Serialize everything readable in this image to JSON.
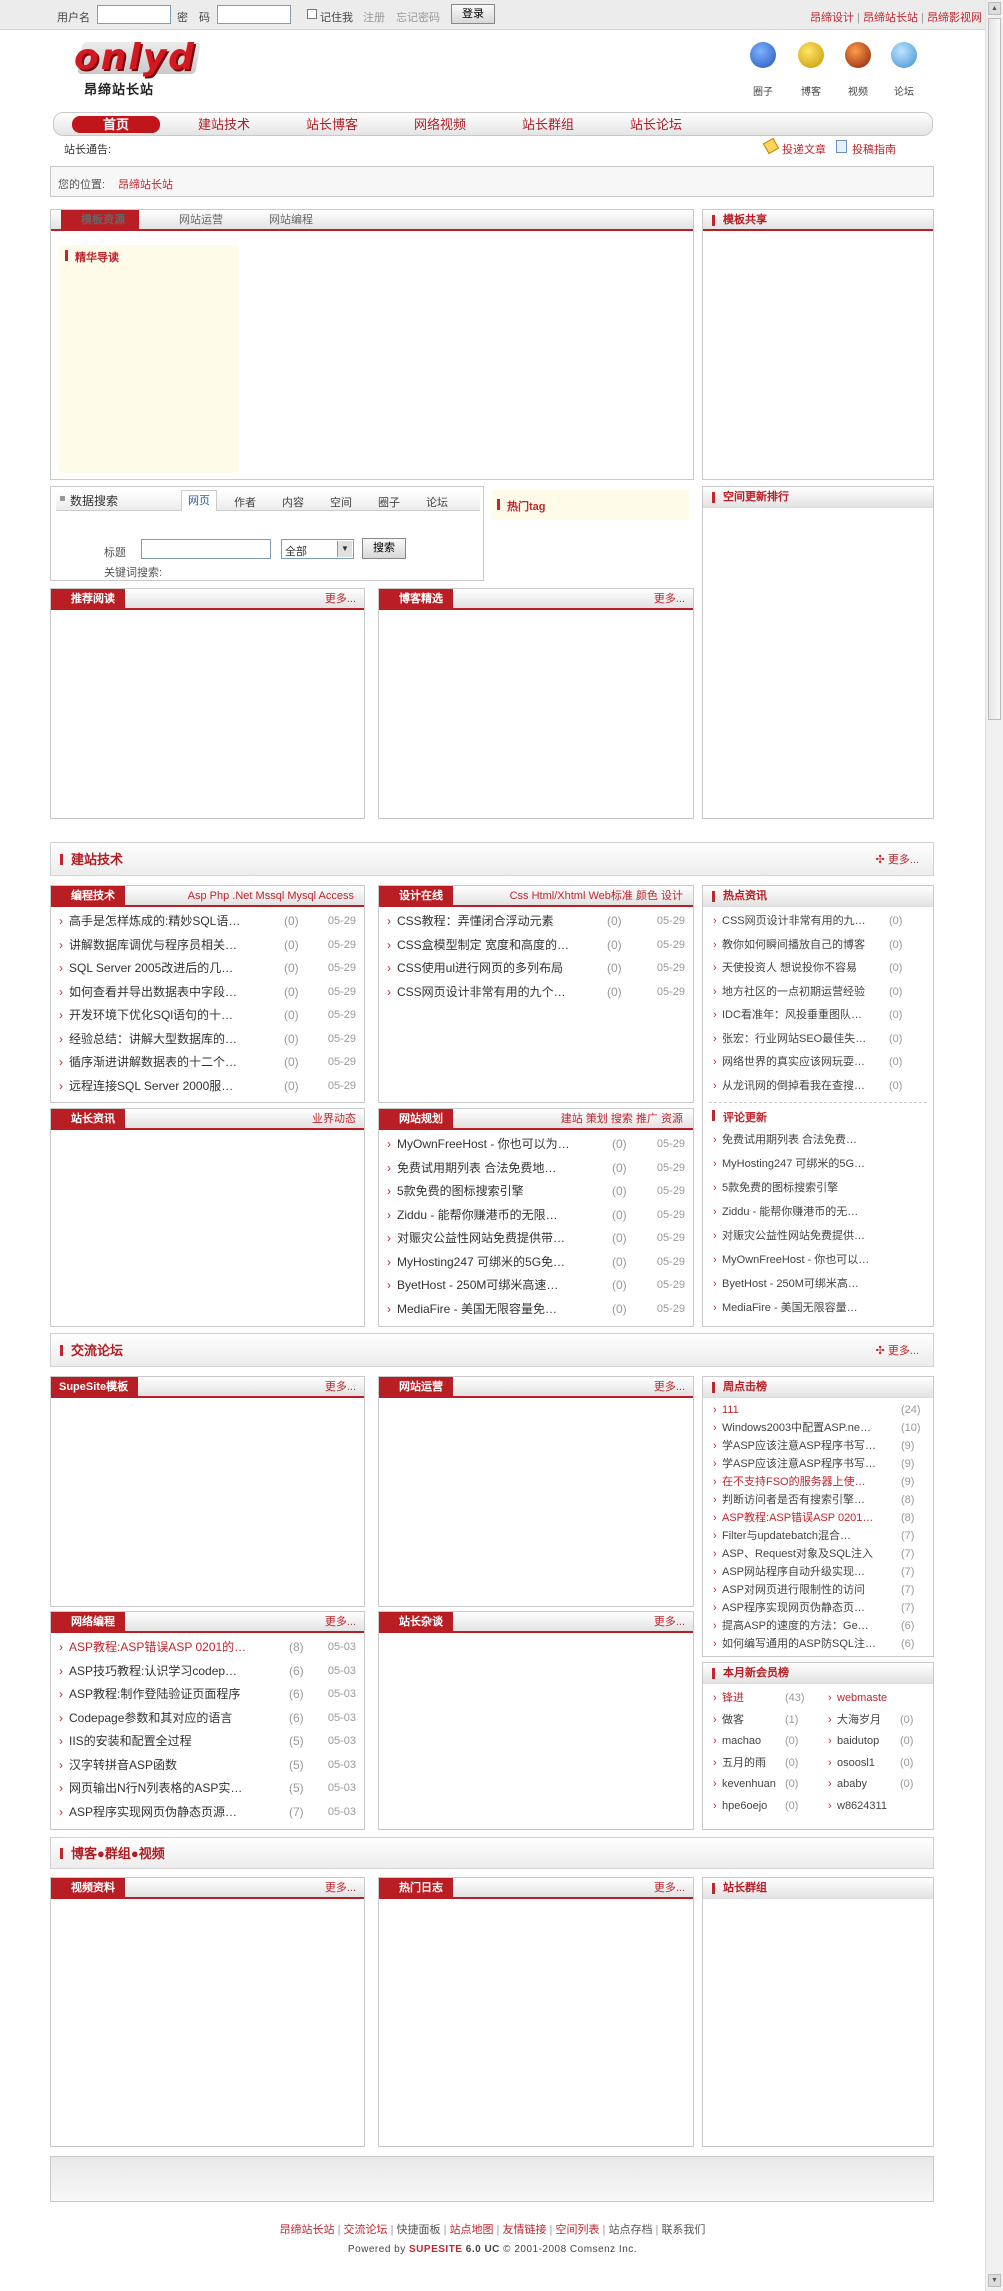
{
  "topbar": {
    "username_label": "用户名",
    "password_label": "密　码",
    "remember_label": "记住我",
    "register_label": "注册",
    "forgot_label": "忘记密码",
    "login_button": "登录",
    "right_links": [
      "昂缔设计",
      "昂缔站长站",
      "昂缔影视网"
    ]
  },
  "logo": {
    "text": "onlyd",
    "subtitle": "昂缔站长站"
  },
  "top_icons": [
    "圈子",
    "博客",
    "视频",
    "论坛"
  ],
  "nav": [
    "首页",
    "建站技术",
    "站长博客",
    "网络视频",
    "站长群组",
    "站长论坛"
  ],
  "notice": {
    "label": "站长通告:",
    "post_link": "投递文章",
    "guide_link": "投稿指南"
  },
  "breadcrumb": {
    "label": "您的位置:",
    "link": "昂缔站长站"
  },
  "tpl_panel": {
    "tabs": [
      "模板资源",
      "网站运营",
      "网站编程"
    ],
    "inner_title": "精华导读"
  },
  "tpl_share": {
    "title": "模板共享"
  },
  "search": {
    "title": "数据搜索",
    "tabs": [
      "网页",
      "作者",
      "内容",
      "空间",
      "圈子",
      "论坛"
    ],
    "field_label": "标题",
    "select_value": "全部",
    "button": "搜索",
    "keywords_label": "关键词搜索:"
  },
  "hot_tag": {
    "title": "热门tag"
  },
  "space_rank": {
    "title": "空间更新排行"
  },
  "recommend": {
    "title": "推荐阅读",
    "more": "更多..."
  },
  "blog_pick": {
    "title": "博客精选",
    "more": "更多..."
  },
  "sec_tech": {
    "title": "建站技术",
    "more": "更多..."
  },
  "prog": {
    "title": "编程技术",
    "links": [
      "Asp",
      "Php",
      ".Net",
      "Mssql",
      "Mysql",
      "Access"
    ],
    "items": [
      {
        "t": "高手是怎样炼成的:精妙SQL语…",
        "c": "(0)",
        "d": "05-29"
      },
      {
        "t": "讲解数据库调优与程序员相关…",
        "c": "(0)",
        "d": "05-29"
      },
      {
        "t": "SQL Server 2005改进后的几…",
        "c": "(0)",
        "d": "05-29"
      },
      {
        "t": "如何查看并导出数据表中字段…",
        "c": "(0)",
        "d": "05-29"
      },
      {
        "t": "开发环境下优化SQl语句的十…",
        "c": "(0)",
        "d": "05-29"
      },
      {
        "t": "经验总结：讲解大型数据库的…",
        "c": "(0)",
        "d": "05-29"
      },
      {
        "t": "循序渐进讲解数据表的十二个…",
        "c": "(0)",
        "d": "05-29"
      },
      {
        "t": "远程连接SQL Server 2000服…",
        "c": "(0)",
        "d": "05-29"
      }
    ]
  },
  "design": {
    "title": "设计在线",
    "links": [
      "Css",
      "Html/Xhtml",
      "Web标准",
      "颜色",
      "设计"
    ],
    "items": [
      {
        "t": "CSS教程：弄懂闭合浮动元素",
        "c": "(0)",
        "d": "05-29"
      },
      {
        "t": "CSS盒模型制定 宽度和高度的…",
        "c": "(0)",
        "d": "05-29"
      },
      {
        "t": "CSS使用ul进行网页的多列布局",
        "c": "(0)",
        "d": "05-29"
      },
      {
        "t": "CSS网页设计非常有用的九个…",
        "c": "(0)",
        "d": "05-29"
      }
    ]
  },
  "hot_news": {
    "title": "热点资讯",
    "items": [
      {
        "t": "CSS网页设计非常有用的九…",
        "c": "(0)"
      },
      {
        "t": "教你如何瞬间播放自己的博客",
        "c": "(0)"
      },
      {
        "t": "天使投资人 想说投你不容易",
        "c": "(0)"
      },
      {
        "t": "地方社区的一点初期运营经验",
        "c": "(0)"
      },
      {
        "t": "IDC看准年：风投垂重图队…",
        "c": "(0)"
      },
      {
        "t": "张宏：行业网站SEO最佳失…",
        "c": "(0)"
      },
      {
        "t": "网络世界的真实应该网玩耍…",
        "c": "(0)"
      },
      {
        "t": "从龙讯网的倒掉看我在查搜…",
        "c": "(0)"
      }
    ]
  },
  "webmaster_news": {
    "title": "站长资讯",
    "more": "业界动态"
  },
  "site_plan": {
    "title": "网站规划",
    "links": [
      "建站",
      "策划",
      "搜索",
      "推广",
      "资源"
    ],
    "items": [
      {
        "t": "MyOwnFreeHost - 你也可以为…",
        "c": "(0)",
        "d": "05-29"
      },
      {
        "t": "免费试用期列表 合法免费地…",
        "c": "(0)",
        "d": "05-29"
      },
      {
        "t": "5款免费的图标搜索引擎",
        "c": "(0)",
        "d": "05-29"
      },
      {
        "t": "Ziddu - 能帮你赚港币的无限…",
        "c": "(0)",
        "d": "05-29"
      },
      {
        "t": "对赈灾公益性网站免费提供带…",
        "c": "(0)",
        "d": "05-29"
      },
      {
        "t": "MyHosting247 可绑米的5G免…",
        "c": "(0)",
        "d": "05-29"
      },
      {
        "t": "ByetHost - 250M可绑米高速…",
        "c": "(0)",
        "d": "05-29"
      },
      {
        "t": "MediaFire - 美国无限容量免…",
        "c": "(0)",
        "d": "05-29"
      }
    ]
  },
  "comment_update": {
    "title": "评论更新",
    "items": [
      "免费试用期列表 合法免费…",
      "MyHosting247 可绑米的5G…",
      "5款免费的图标搜索引擎",
      "Ziddu - 能帮你赚港币的无…",
      "对赈灾公益性网站免费提供…",
      "MyOwnFreeHost - 你也可以…",
      "ByetHost - 250M可绑米高…",
      "MediaFire - 美国无限容量…"
    ]
  },
  "sec_forum": {
    "title": "交流论坛",
    "more": "更多..."
  },
  "supesite": {
    "title": "SupeSite模板",
    "more": "更多..."
  },
  "site_ops": {
    "title": "网站运营",
    "more": "更多..."
  },
  "weekly_hits": {
    "title": "周点击榜",
    "items": [
      {
        "t": "111",
        "c": "(24)",
        "hot": true
      },
      {
        "t": "Windows2003中配置ASP.ne…",
        "c": "(10)",
        "hot": false
      },
      {
        "t": "学ASP应该注意ASP程序书写…",
        "c": "(9)",
        "hot": false
      },
      {
        "t": "学ASP应该注意ASP程序书写…",
        "c": "(9)",
        "hot": false
      },
      {
        "t": "在不支持FSO的服务器上使…",
        "c": "(9)",
        "hot": true
      },
      {
        "t": "判断访问者是否有搜索引擎…",
        "c": "(8)",
        "hot": false
      },
      {
        "t": "ASP教程:ASP错误ASP 0201…",
        "c": "(8)",
        "hot": true
      },
      {
        "t": "Filter与updatebatch混合…",
        "c": "(7)",
        "hot": false
      },
      {
        "t": "ASP、Request对象及SQL注入",
        "c": "(7)",
        "hot": false
      },
      {
        "t": "ASP网站程序自动升级实现…",
        "c": "(7)",
        "hot": false
      },
      {
        "t": "ASP对网页进行限制性的访问",
        "c": "(7)",
        "hot": false
      },
      {
        "t": "ASP程序实现网页伪静态页…",
        "c": "(7)",
        "hot": false
      },
      {
        "t": "提高ASP的速度的方法：Ge…",
        "c": "(6)",
        "hot": false
      },
      {
        "t": "如何编写通用的ASP防SQL注…",
        "c": "(6)",
        "hot": false
      }
    ]
  },
  "net_prog": {
    "title": "网络编程",
    "more": "更多...",
    "items": [
      {
        "t": "ASP教程:ASP错误ASP 0201的…",
        "c": "(8)",
        "d": "05-03",
        "hot": true
      },
      {
        "t": "ASP技巧教程:认识学习codep…",
        "c": "(6)",
        "d": "05-03",
        "hot": false
      },
      {
        "t": "ASP教程:制作登陆验证页面程序",
        "c": "(6)",
        "d": "05-03",
        "hot": false
      },
      {
        "t": "Codepage参数和其对应的语言",
        "c": "(6)",
        "d": "05-03",
        "hot": false
      },
      {
        "t": "IIS的安装和配置全过程",
        "c": "(5)",
        "d": "05-03",
        "hot": false
      },
      {
        "t": "汉字转拼音ASP函数",
        "c": "(5)",
        "d": "05-03",
        "hot": false
      },
      {
        "t": "网页输出N行N列表格的ASP实…",
        "c": "(5)",
        "d": "05-03",
        "hot": false
      },
      {
        "t": "ASP程序实现网页伪静态页源…",
        "c": "(7)",
        "d": "05-03",
        "hot": false
      }
    ]
  },
  "webmaster_misc": {
    "title": "站长杂谈",
    "more": "更多..."
  },
  "new_members": {
    "title": "本月新会员榜",
    "left": [
      {
        "n": "锋进",
        "c": "(43)",
        "hot": true
      },
      {
        "n": "做客",
        "c": "(1)",
        "hot": false
      },
      {
        "n": "machao",
        "c": "(0)",
        "hot": false
      },
      {
        "n": "五月的雨",
        "c": "(0)",
        "hot": false
      },
      {
        "n": "kevenhuan",
        "c": "(0)",
        "hot": false
      },
      {
        "n": "hpe6oejo",
        "c": "(0)",
        "hot": false
      }
    ],
    "right": [
      {
        "n": "webmaste",
        "c": "",
        "hot": true
      },
      {
        "n": "大海岁月",
        "c": "(0)",
        "hot": false
      },
      {
        "n": "baidutop",
        "c": "(0)",
        "hot": false
      },
      {
        "n": "osoosl1",
        "c": "(0)",
        "hot": false
      },
      {
        "n": "ababy",
        "c": "(0)",
        "hot": false
      },
      {
        "n": "w8624311",
        "c": "",
        "hot": false
      }
    ]
  },
  "sec_blog": {
    "title": "博客●群组●视频"
  },
  "video": {
    "title": "视频资料",
    "more": "更多..."
  },
  "hot_log": {
    "title": "热门日志",
    "more": "更多..."
  },
  "groups": {
    "title": "站长群组"
  },
  "footer": {
    "links": [
      "昂缔站长站",
      "交流论坛",
      "快捷面板",
      "站点地图",
      "友情链接",
      "空间列表",
      "站点存档",
      "联系我们"
    ],
    "powered": "Powered by",
    "brand": "SUPESITE",
    "version": "6.0 UC",
    "copyright": "© 2001-2008 Comsenz Inc."
  }
}
